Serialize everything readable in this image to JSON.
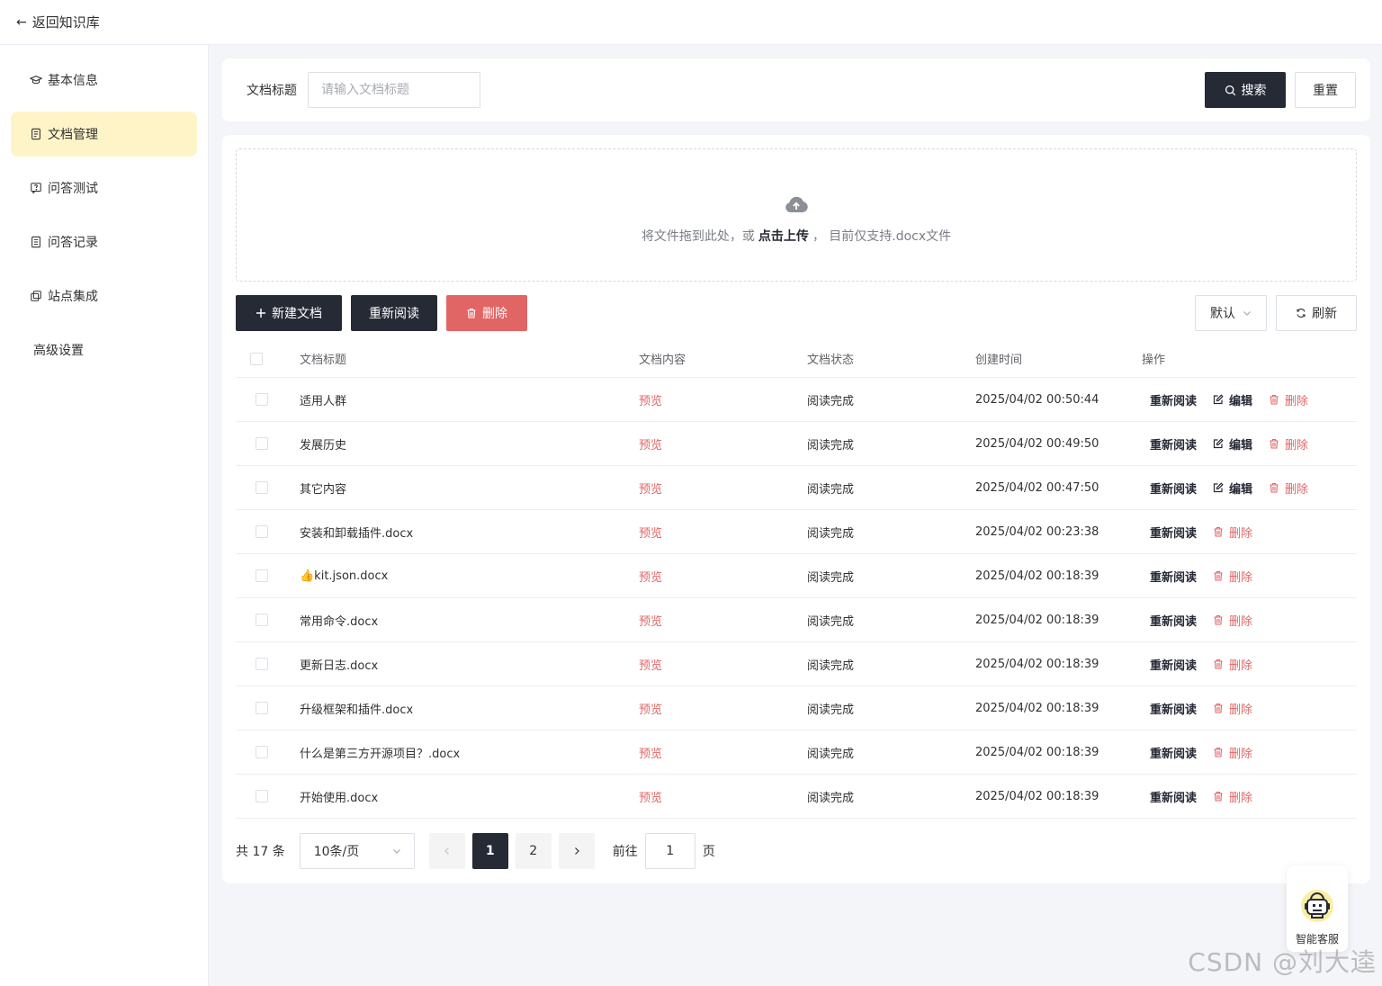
{
  "topbar": {
    "back_label": "返回知识库"
  },
  "sidebar": {
    "items": [
      {
        "label": "基本信息",
        "icon": "graduation-cap-icon"
      },
      {
        "label": "文档管理",
        "icon": "document-icon",
        "active": true
      },
      {
        "label": "问答测试",
        "icon": "question-chat-icon"
      },
      {
        "label": "问答记录",
        "icon": "record-list-icon"
      },
      {
        "label": "站点集成",
        "icon": "copy-integration-icon"
      },
      {
        "label": "高级设置"
      }
    ]
  },
  "search": {
    "label": "文档标题",
    "placeholder": "请输入文档标题",
    "search_button": "搜索",
    "reset_button": "重置"
  },
  "upload": {
    "text_before": "将文件拖到此处，或",
    "link": "点击上传",
    "text_after": "， 目前仅支持.docx文件"
  },
  "toolbar": {
    "new_button": "新建文档",
    "reread_button": "重新阅读",
    "delete_button": "删除",
    "sort_select": "默认",
    "refresh_button": "刷新"
  },
  "table": {
    "headers": [
      "文档标题",
      "文档内容",
      "文档状态",
      "创建时间",
      "操作"
    ],
    "preview_label": "预览",
    "op_reread": "重新阅读",
    "op_edit": "编辑",
    "op_delete": "删除",
    "rows": [
      {
        "title": "适用人群",
        "status": "阅读完成",
        "time": "2025/04/02 00:50:44",
        "editable": true
      },
      {
        "title": "发展历史",
        "status": "阅读完成",
        "time": "2025/04/02 00:49:50",
        "editable": true
      },
      {
        "title": "其它内容",
        "status": "阅读完成",
        "time": "2025/04/02 00:47:50",
        "editable": true
      },
      {
        "title": "安装和卸载插件.docx",
        "status": "阅读完成",
        "time": "2025/04/02 00:23:38",
        "editable": false
      },
      {
        "title": "👍kit.json.docx",
        "status": "阅读完成",
        "time": "2025/04/02 00:18:39",
        "editable": false
      },
      {
        "title": "常用命令.docx",
        "status": "阅读完成",
        "time": "2025/04/02 00:18:39",
        "editable": false
      },
      {
        "title": "更新日志.docx",
        "status": "阅读完成",
        "time": "2025/04/02 00:18:39",
        "editable": false
      },
      {
        "title": "升级框架和插件.docx",
        "status": "阅读完成",
        "time": "2025/04/02 00:18:39",
        "editable": false
      },
      {
        "title": "什么是第三方开源项目？.docx",
        "status": "阅读完成",
        "time": "2025/04/02 00:18:39",
        "editable": false
      },
      {
        "title": "开始使用.docx",
        "status": "阅读完成",
        "time": "2025/04/02 00:18:39",
        "editable": false
      }
    ]
  },
  "pagination": {
    "total_text": "共 17 条",
    "page_size": "10条/页",
    "pages": [
      "1",
      "2"
    ],
    "current": "1",
    "goto_label": "前往",
    "goto_value": "1",
    "page_suffix": "页"
  },
  "support_widget": {
    "label": "智能客服"
  },
  "watermark": "CSDN @刘大逵",
  "colors": {
    "dark": "#262a35",
    "danger": "#e26565",
    "active_bg": "#fef4c8"
  }
}
